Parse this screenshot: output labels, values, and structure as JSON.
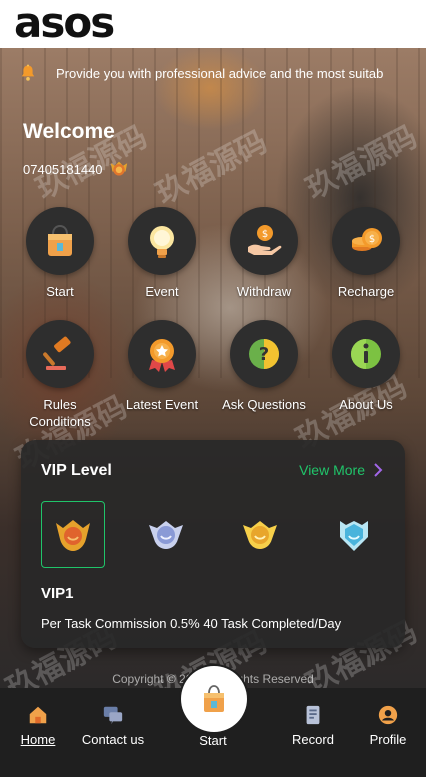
{
  "brand": {
    "logo": "asos"
  },
  "notice": {
    "icon": "bell-icon",
    "text": "Provide you with professional advice and the most suitab"
  },
  "user": {
    "welcome": "Welcome",
    "phone": "07405181440",
    "badge_icon": "vip-medal-icon"
  },
  "actions": [
    {
      "label": "Start",
      "icon": "shopping-bag-icon"
    },
    {
      "label": "Event",
      "icon": "lightbulb-icon"
    },
    {
      "label": "Withdraw",
      "icon": "hand-coin-icon"
    },
    {
      "label": "Recharge",
      "icon": "coin-stack-icon"
    },
    {
      "label": "Rules Conditions",
      "icon": "gavel-icon"
    },
    {
      "label": "Latest Event",
      "icon": "award-ribbon-icon"
    },
    {
      "label": "Ask Questions",
      "icon": "question-icon"
    },
    {
      "label": "About Us",
      "icon": "info-icon"
    }
  ],
  "vip": {
    "title": "VIP Level",
    "more_label": "View More",
    "badges": [
      "vip1-badge-icon",
      "vip2-badge-icon",
      "vip3-badge-icon",
      "vip4-badge-icon"
    ],
    "selected_name": "VIP1",
    "description": "Per Task Commission 0.5% 40 Task Completed/Day"
  },
  "footer": {
    "copyright": "Copyright © 2022 All Rights Reserved"
  },
  "tabbar": {
    "items": [
      {
        "label": "Home",
        "icon": "home-icon",
        "active": true
      },
      {
        "label": "Contact us",
        "icon": "chat-icon",
        "active": false
      },
      {
        "label": "Start",
        "icon": "shopping-bag-icon",
        "active": false
      },
      {
        "label": "Record",
        "icon": "receipt-icon",
        "active": false
      },
      {
        "label": "Profile",
        "icon": "user-icon",
        "active": false
      }
    ]
  },
  "colors": {
    "accent_green": "#20c46a",
    "chevron_purple": "#a266e8",
    "tabbar_bg": "#1f1f1f"
  },
  "watermark_text": "玖福源码"
}
